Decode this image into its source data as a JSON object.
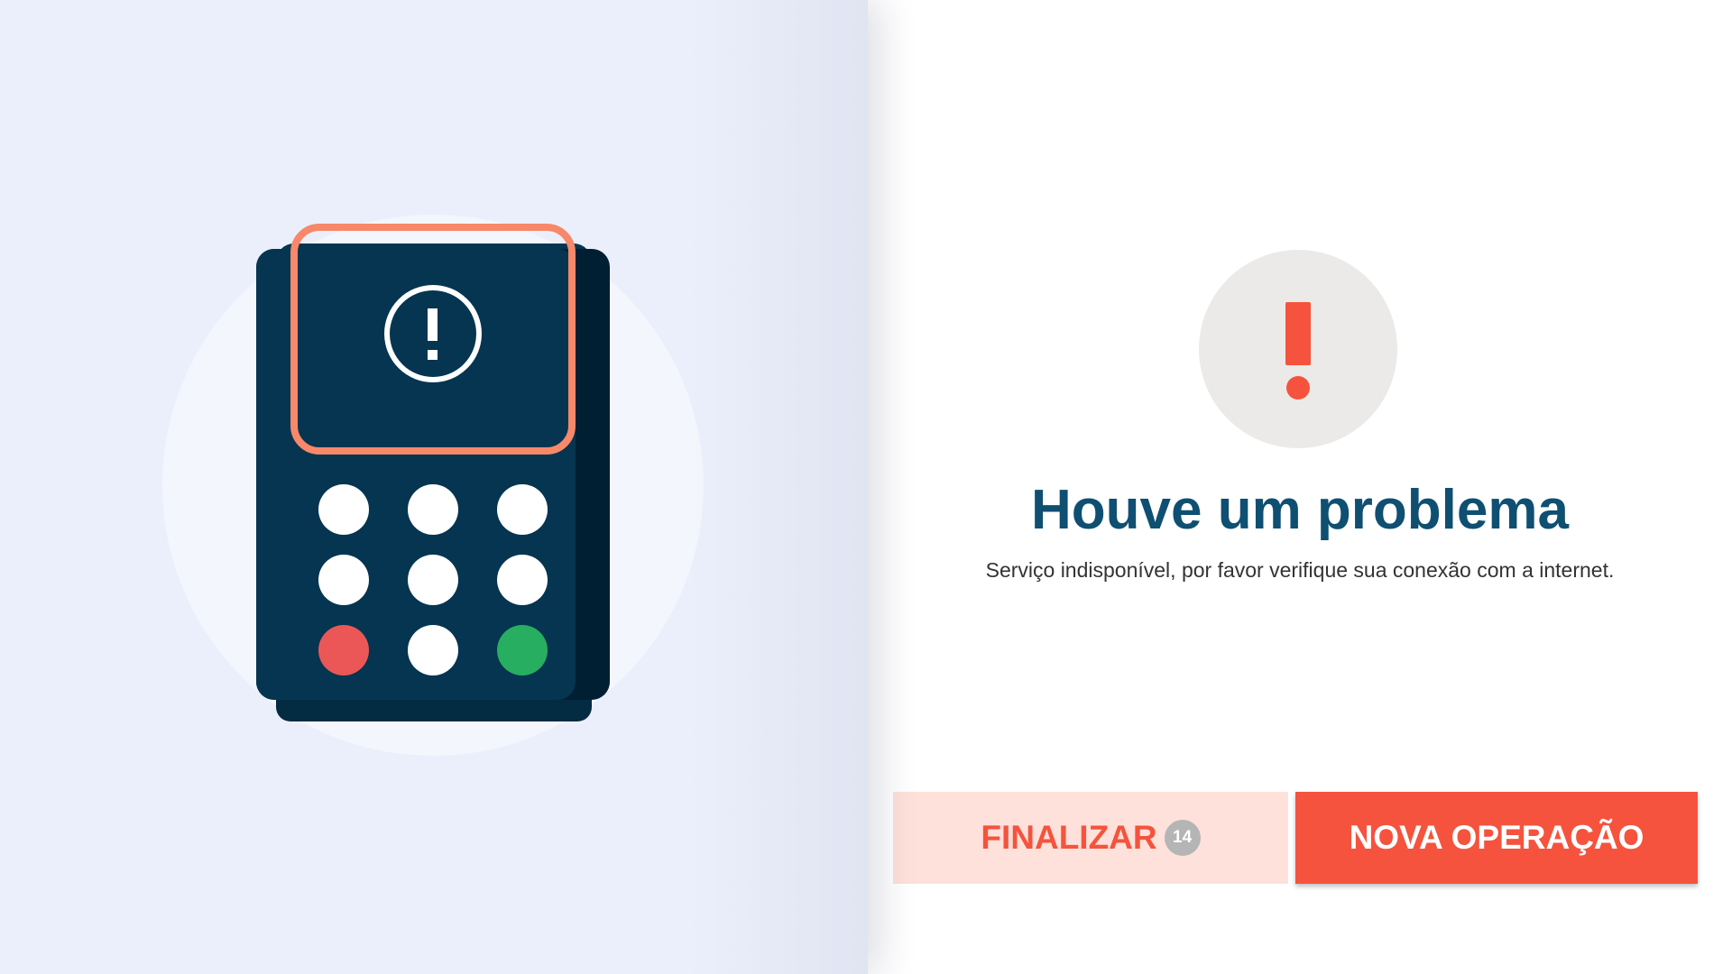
{
  "illustration": {
    "name": "card-terminal-error",
    "icon": "exclamation-circle-icon",
    "colors": {
      "device": "#053550",
      "highlight": "#f78869",
      "cancel_key": "#eb5757",
      "confirm_key": "#27ae60"
    }
  },
  "message": {
    "icon": "exclamation-icon",
    "title": "Houve um problema",
    "description": "Serviço indisponível, por favor verifique sua conexão com a internet."
  },
  "actions": {
    "finalize_label": "FINALIZAR",
    "finalize_countdown": "14",
    "new_operation_label": "NOVA OPERAÇÃO"
  },
  "colors": {
    "accent": "#f5533d",
    "title": "#0f4f72",
    "left_background": "#ebeffb"
  }
}
